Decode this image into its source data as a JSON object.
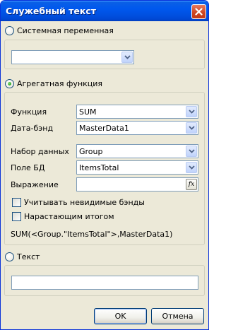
{
  "window": {
    "title": "Служебный текст"
  },
  "system_variable": {
    "radio_label": "Системная переменная",
    "value": ""
  },
  "aggregate": {
    "radio_label": "Агрегатная функция",
    "function_label": "Функция",
    "function_value": "SUM",
    "databand_label": "Дата-бэнд",
    "databand_value": "MasterData1",
    "dataset_label": "Набор данных",
    "dataset_value": "Group",
    "field_label": "Поле БД",
    "field_value": "ItemsTotal",
    "expression_label": "Выражение",
    "expression_value": "",
    "fx_label": "fx",
    "invisible_bands_label": "Учитывать невидимые бэнды",
    "running_total_label": "Нарастающим итогом",
    "result_expression": "SUM(<Group.\"ItemsTotal\">,MasterData1)"
  },
  "text": {
    "radio_label": "Текст",
    "value": ""
  },
  "buttons": {
    "ok": "OK",
    "cancel": "Отмена"
  }
}
